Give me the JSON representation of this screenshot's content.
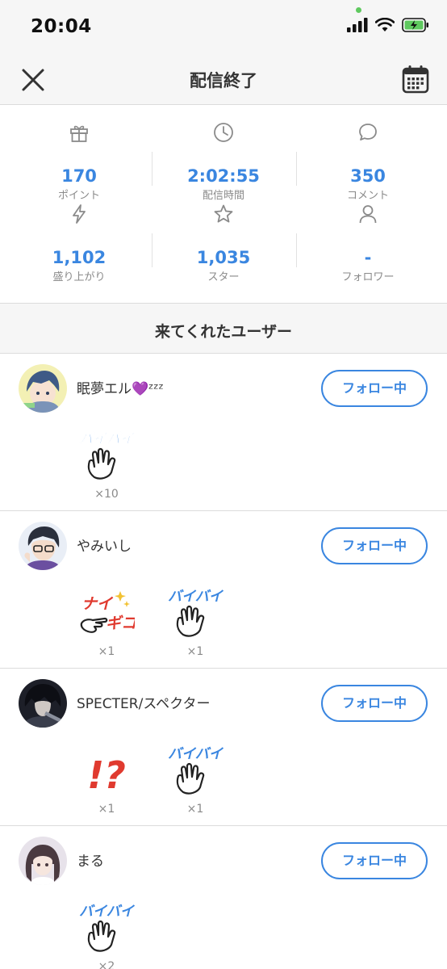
{
  "status_bar": {
    "time": "20:04"
  },
  "header": {
    "title": "配信終了"
  },
  "stats": [
    {
      "icon": "gift-icon",
      "value": "170",
      "label": "ポイント"
    },
    {
      "icon": "clock-icon",
      "value": "2:02:55",
      "label": "配信時間"
    },
    {
      "icon": "comment-icon",
      "value": "350",
      "label": "コメント"
    },
    {
      "icon": "lightning-icon",
      "value": "1,102",
      "label": "盛り上がり"
    },
    {
      "icon": "star-icon",
      "value": "1,035",
      "label": "スター"
    },
    {
      "icon": "person-icon",
      "value": "-",
      "label": "フォロワー"
    }
  ],
  "section": {
    "title": "来てくれたユーザー"
  },
  "users": [
    {
      "name": "眠夢エル💜ᶻᶻᶻ",
      "follow_label": "フォロー中",
      "stamps": [
        {
          "type": "baibai",
          "text": "バイバイ",
          "count": "×10"
        }
      ]
    },
    {
      "name": "やみいし",
      "follow_label": "フォロー中",
      "stamps": [
        {
          "type": "naisu",
          "text_line1": "ナイ",
          "text_line2": "ギコ",
          "count": "×1"
        },
        {
          "type": "baibai",
          "text": "バイバイ",
          "count": "×1"
        }
      ]
    },
    {
      "name": "SPECTER/スペクター",
      "follow_label": "フォロー中",
      "stamps": [
        {
          "type": "exclaim",
          "text": "!?",
          "count": "×1"
        },
        {
          "type": "baibai",
          "text": "バイバイ",
          "count": "×1"
        }
      ]
    },
    {
      "name": "まる",
      "follow_label": "フォロー中",
      "stamps": [
        {
          "type": "baibai",
          "text": "バイバイ",
          "count": "×2"
        }
      ]
    }
  ],
  "colors": {
    "accent": "#3a86e0",
    "divider": "#dcdcdc",
    "muted": "#8a8a8a",
    "stamp_red": "#e03a2f"
  }
}
